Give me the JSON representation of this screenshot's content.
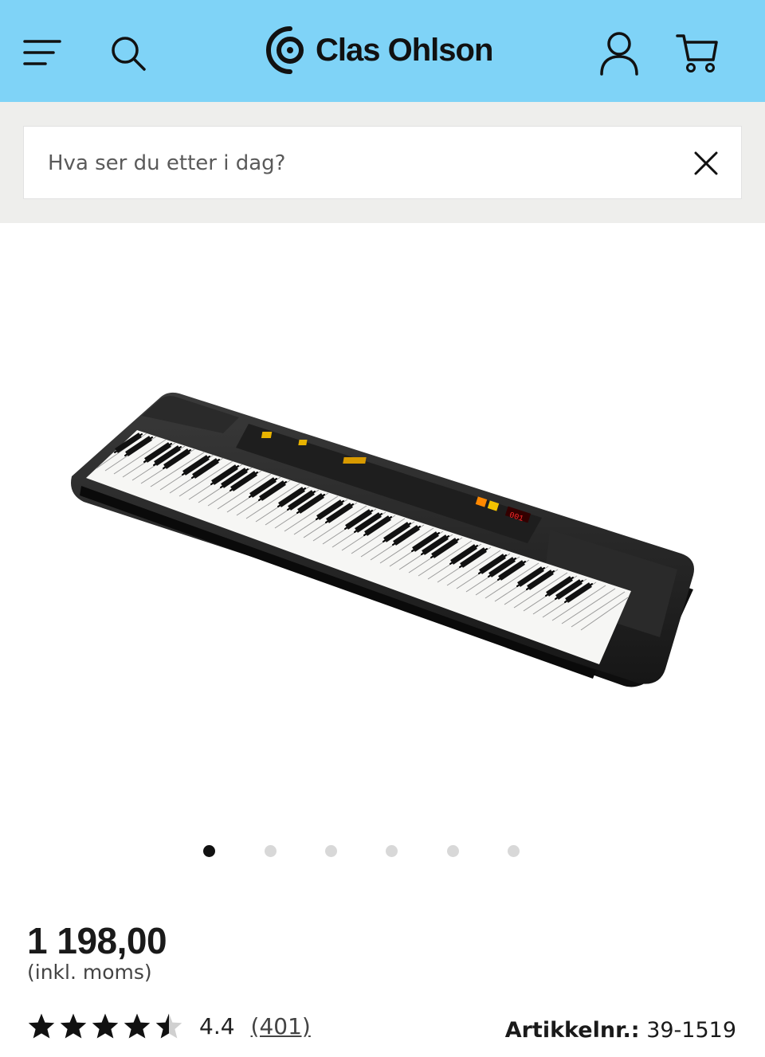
{
  "header": {
    "brand": "Clas Ohlson",
    "icons": {
      "menu": "hamburger-menu-icon",
      "search": "search-icon",
      "account": "user-account-icon",
      "cart": "shopping-cart-icon"
    },
    "background_color": "#7fd3f7"
  },
  "search": {
    "placeholder": "Hva ser du etter i dag?",
    "clear_icon": "close-icon"
  },
  "product": {
    "image_subject": "black keyboard",
    "carousel": {
      "total": 6,
      "active_index": 0
    },
    "price": "1 198,00",
    "vat_note": "(inkl. moms)",
    "rating": {
      "stars_out_of_5": 4.4,
      "value": "4.4",
      "count": "(401)"
    },
    "article_number": {
      "label": "Artikkelnr.:",
      "value": "39-1519"
    }
  }
}
